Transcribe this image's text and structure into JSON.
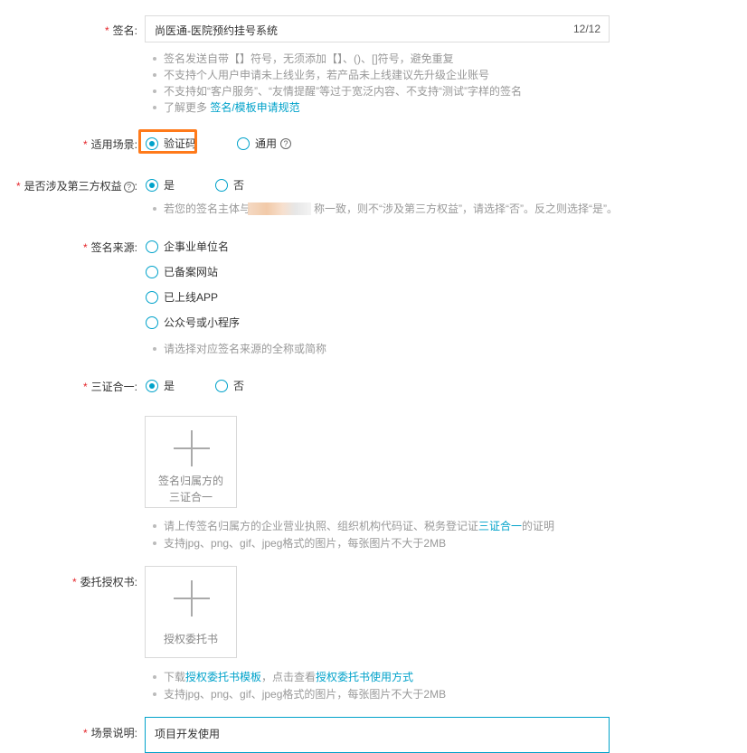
{
  "signature": {
    "label": "签名:",
    "value": "尚医通-医院预约挂号系统",
    "count": "12/12",
    "hints": [
      "签名发送自带【】符号，无须添加【】、()、[]符号，避免重复",
      "不支持个人用户申请未上线业务，若产品未上线建议先升级企业账号",
      "不支持如“客户服务”、“友情提醒”等过于宽泛内容、不支持“测试”字样的签名"
    ],
    "more_prefix": "了解更多 ",
    "more_link": "签名/模板申请规范"
  },
  "scene": {
    "label": "适用场景:",
    "options": [
      "验证码",
      "通用"
    ],
    "selected": "验证码"
  },
  "third_party": {
    "label": "是否涉及第三方权益",
    "options": [
      "是",
      "否"
    ],
    "selected": "是",
    "hint_a": "若您的签名主体与",
    "hint_b": "称一致，则不“涉及第三方权益”，请选择“否”。反之则选择“是”。"
  },
  "source": {
    "label": "签名来源:",
    "options": [
      "企事业单位名",
      "已备案网站",
      "已上线APP",
      "公众号或小程序"
    ],
    "hint": "请选择对应签名来源的全称或简称"
  },
  "three_in_one": {
    "label": "三证合一:",
    "options": [
      "是",
      "否"
    ],
    "selected": "是",
    "upload_line1": "签名归属方的",
    "upload_line2": "三证合一",
    "hint1_a": "请上传签名归属方的企业营业执照、组织机构代码证、税务登记证",
    "hint1_link": "三证合一",
    "hint1_b": "的证明",
    "hint2": "支持jpg、png、gif、jpeg格式的图片，每张图片不大于2MB"
  },
  "authorization": {
    "label": "委托授权书:",
    "upload_text": "授权委托书",
    "hint1_a": "下载",
    "hint1_link1": "授权委托书模板",
    "hint1_b": "，点击查看",
    "hint1_link2": "授权委托书使用方式",
    "hint2": "支持jpg、png、gif、jpeg格式的图片，每张图片不大于2MB"
  },
  "description": {
    "label": "场景说明:",
    "value": "项目开发使用"
  },
  "colors": {
    "accent": "#00a2ca",
    "required": "#e5262b",
    "highlight": "#ff7a1a"
  }
}
